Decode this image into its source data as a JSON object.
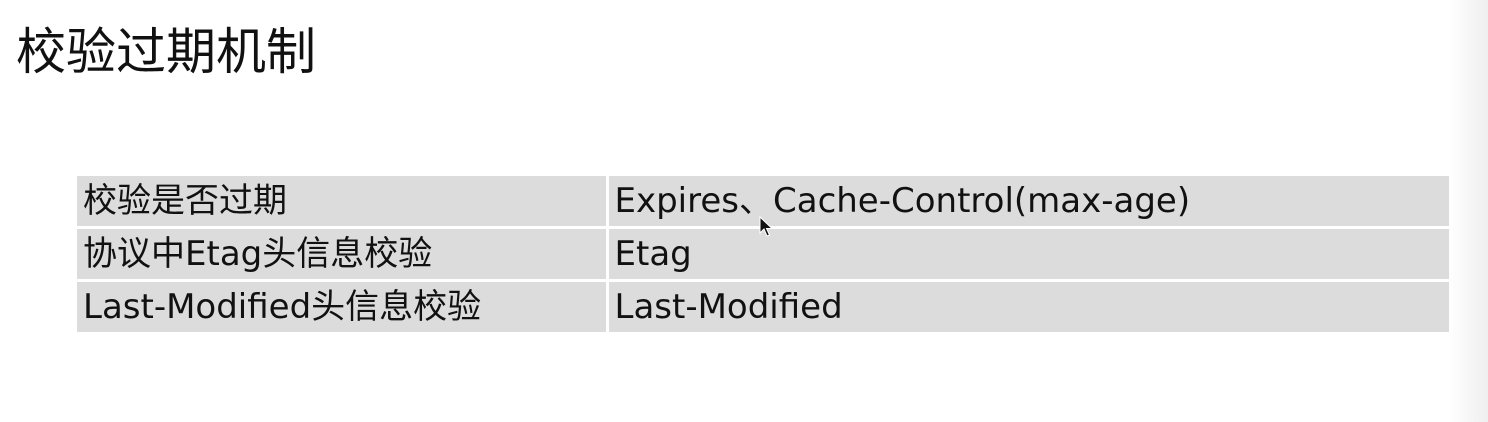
{
  "slide": {
    "title": "校验过期机制"
  },
  "table": {
    "rows": [
      {
        "label": "校验是否过期",
        "value": "Expires、Cache-Control(max-age)"
      },
      {
        "label": "协议中Etag头信息校验",
        "value": "Etag"
      },
      {
        "label": "Last-Modified头信息校验",
        "value": "Last-Modified"
      }
    ]
  },
  "icons": {
    "cursor": "mouse-pointer-icon"
  }
}
